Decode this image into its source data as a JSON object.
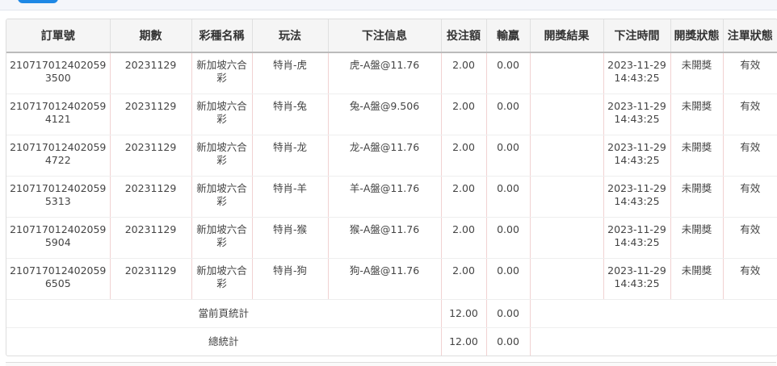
{
  "table": {
    "headers": [
      "訂單號",
      "期數",
      "彩種名稱",
      "玩法",
      "下注信息",
      "投注額",
      "輸贏",
      "開獎結果",
      "下注時間",
      "開獎狀態",
      "注單狀態"
    ],
    "rows": [
      {
        "order_no": "2107170124020593500",
        "period": "20231129",
        "lottery": "新加坡六合彩",
        "play": "特肖-虎",
        "bet_info": "虎-A盤@11.76",
        "amount": "2.00",
        "win_loss": "0.00",
        "result": "",
        "bet_time": "2023-11-29 14:43:25",
        "draw_status": "未開獎",
        "order_status": "有效"
      },
      {
        "order_no": "2107170124020594121",
        "period": "20231129",
        "lottery": "新加坡六合彩",
        "play": "特肖-兔",
        "bet_info": "兔-A盤@9.506",
        "amount": "2.00",
        "win_loss": "0.00",
        "result": "",
        "bet_time": "2023-11-29 14:43:25",
        "draw_status": "未開獎",
        "order_status": "有效"
      },
      {
        "order_no": "2107170124020594722",
        "period": "20231129",
        "lottery": "新加坡六合彩",
        "play": "特肖-龙",
        "bet_info": "龙-A盤@11.76",
        "amount": "2.00",
        "win_loss": "0.00",
        "result": "",
        "bet_time": "2023-11-29 14:43:25",
        "draw_status": "未開獎",
        "order_status": "有效"
      },
      {
        "order_no": "2107170124020595313",
        "period": "20231129",
        "lottery": "新加坡六合彩",
        "play": "特肖-羊",
        "bet_info": "羊-A盤@11.76",
        "amount": "2.00",
        "win_loss": "0.00",
        "result": "",
        "bet_time": "2023-11-29 14:43:25",
        "draw_status": "未開獎",
        "order_status": "有效"
      },
      {
        "order_no": "2107170124020595904",
        "period": "20231129",
        "lottery": "新加坡六合彩",
        "play": "特肖-猴",
        "bet_info": "猴-A盤@11.76",
        "amount": "2.00",
        "win_loss": "0.00",
        "result": "",
        "bet_time": "2023-11-29 14:43:25",
        "draw_status": "未開獎",
        "order_status": "有效"
      },
      {
        "order_no": "2107170124020596505",
        "period": "20231129",
        "lottery": "新加坡六合彩",
        "play": "特肖-狗",
        "bet_info": "狗-A盤@11.76",
        "amount": "2.00",
        "win_loss": "0.00",
        "result": "",
        "bet_time": "2023-11-29 14:43:25",
        "draw_status": "未開獎",
        "order_status": "有效"
      }
    ],
    "page_total": {
      "label": "當前頁統計",
      "amount": "12.00",
      "win_loss": "0.00"
    },
    "grand_total": {
      "label": "總統計",
      "amount": "12.00",
      "win_loss": "0.00"
    }
  }
}
